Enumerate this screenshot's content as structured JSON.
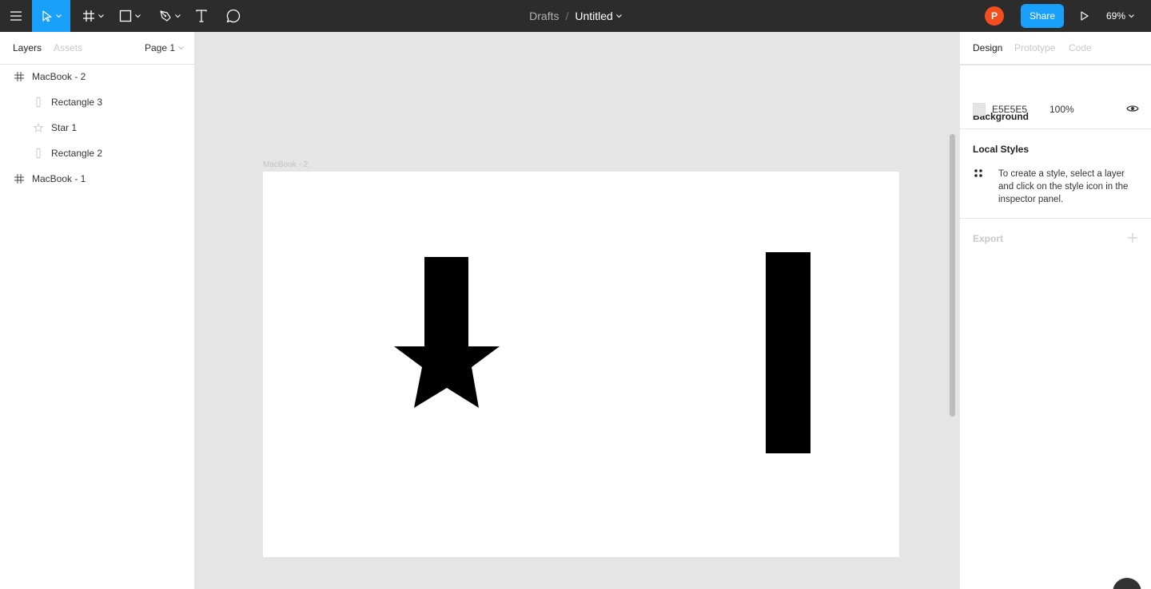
{
  "toolbar": {
    "breadcrumb_parent": "Drafts",
    "breadcrumb_separator": "/",
    "file_name": "Untitled",
    "avatar_initial": "P",
    "share_label": "Share",
    "zoom": "69%",
    "colors": {
      "bar": "#2c2c2c",
      "active_tool": "#18a0fb",
      "share": "#18a0fb",
      "avatar": "#f24e1e"
    },
    "tools": [
      "menu-icon",
      "move-tool-icon",
      "frame-tool-icon",
      "rectangle-tool-icon",
      "pen-tool-icon",
      "text-tool-icon",
      "comment-icon",
      "play-icon"
    ]
  },
  "left_panel": {
    "tabs": [
      {
        "label": "Layers",
        "active": true
      },
      {
        "label": "Assets",
        "active": false
      }
    ],
    "page": "Page 1",
    "layers": [
      {
        "name": "MacBook - 2",
        "icon": "frame-icon",
        "depth": 0
      },
      {
        "name": "Rectangle 3",
        "icon": "rectangle-icon",
        "depth": 1
      },
      {
        "name": "Star 1",
        "icon": "star-icon",
        "depth": 1
      },
      {
        "name": "Rectangle 2",
        "icon": "rectangle-icon",
        "depth": 1
      },
      {
        "name": "MacBook - 1",
        "icon": "frame-icon",
        "depth": 0
      }
    ]
  },
  "canvas": {
    "frame_label": "MacBook - 2",
    "frame_fill": "#ffffff",
    "shape_fill": "#000000",
    "background": "#e5e5e5"
  },
  "right_panel": {
    "tabs": [
      {
        "label": "Design",
        "active": true
      },
      {
        "label": "Prototype",
        "active": false
      },
      {
        "label": "Code",
        "active": false
      }
    ],
    "background": {
      "title": "Background",
      "hex": "E5E5E5",
      "opacity": "100%"
    },
    "local_styles": {
      "title": "Local Styles",
      "hint": "To create a style, select a layer and click on the style icon in the inspector panel."
    },
    "export": {
      "title": "Export"
    }
  }
}
